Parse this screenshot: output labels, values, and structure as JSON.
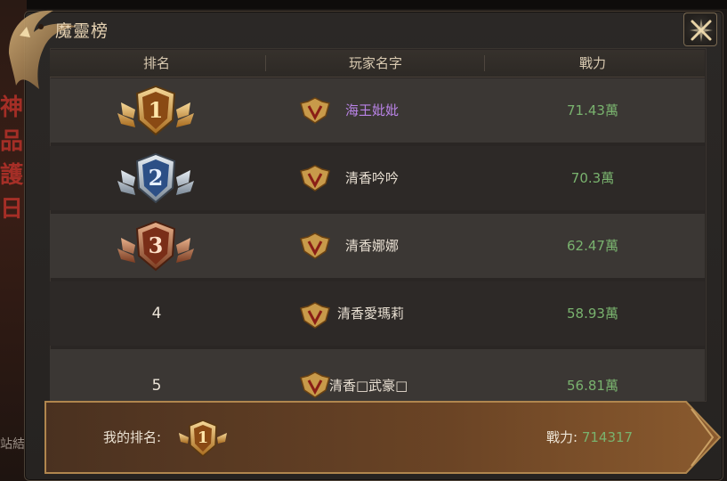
{
  "background": {
    "side_glyphs": [
      "神",
      "品",
      "護",
      "日"
    ],
    "side_label": "站結"
  },
  "panel": {
    "title": "魔靈榜"
  },
  "table": {
    "headers": {
      "rank": "排名",
      "player_name": "玩家名字",
      "power": "戰力"
    },
    "rows": [
      {
        "rank": "1",
        "rank_style": "gold",
        "name": "海王妣妣",
        "name_color": "purple",
        "power": "71.43萬"
      },
      {
        "rank": "2",
        "rank_style": "silver",
        "name": "清香吟吟",
        "name_color": "default",
        "power": "70.3萬"
      },
      {
        "rank": "3",
        "rank_style": "bronze",
        "name": "清香娜娜",
        "name_color": "default",
        "power": "62.47萬"
      },
      {
        "rank": "4",
        "rank_style": "plain",
        "name": "清香愛瑪莉",
        "name_color": "default",
        "power": "58.93萬"
      },
      {
        "rank": "5",
        "rank_style": "plain",
        "name": "清香□武豪□",
        "name_color": "default",
        "power": "56.81萬"
      }
    ]
  },
  "my_rank": {
    "label": "我的排名:",
    "rank": "1",
    "power_label": "戰力:",
    "power_value": "714317"
  },
  "colors": {
    "accent_gold": "#e0b25a",
    "power_green": "#79b26e",
    "name_purple": "#b983e6",
    "title_text": "#e6d2b2"
  },
  "icons": [
    "dragon-ornament-icon",
    "close-icon",
    "vip-v-icon",
    "rank-medal-gold-icon",
    "rank-medal-silver-icon",
    "rank-medal-bronze-icon"
  ]
}
